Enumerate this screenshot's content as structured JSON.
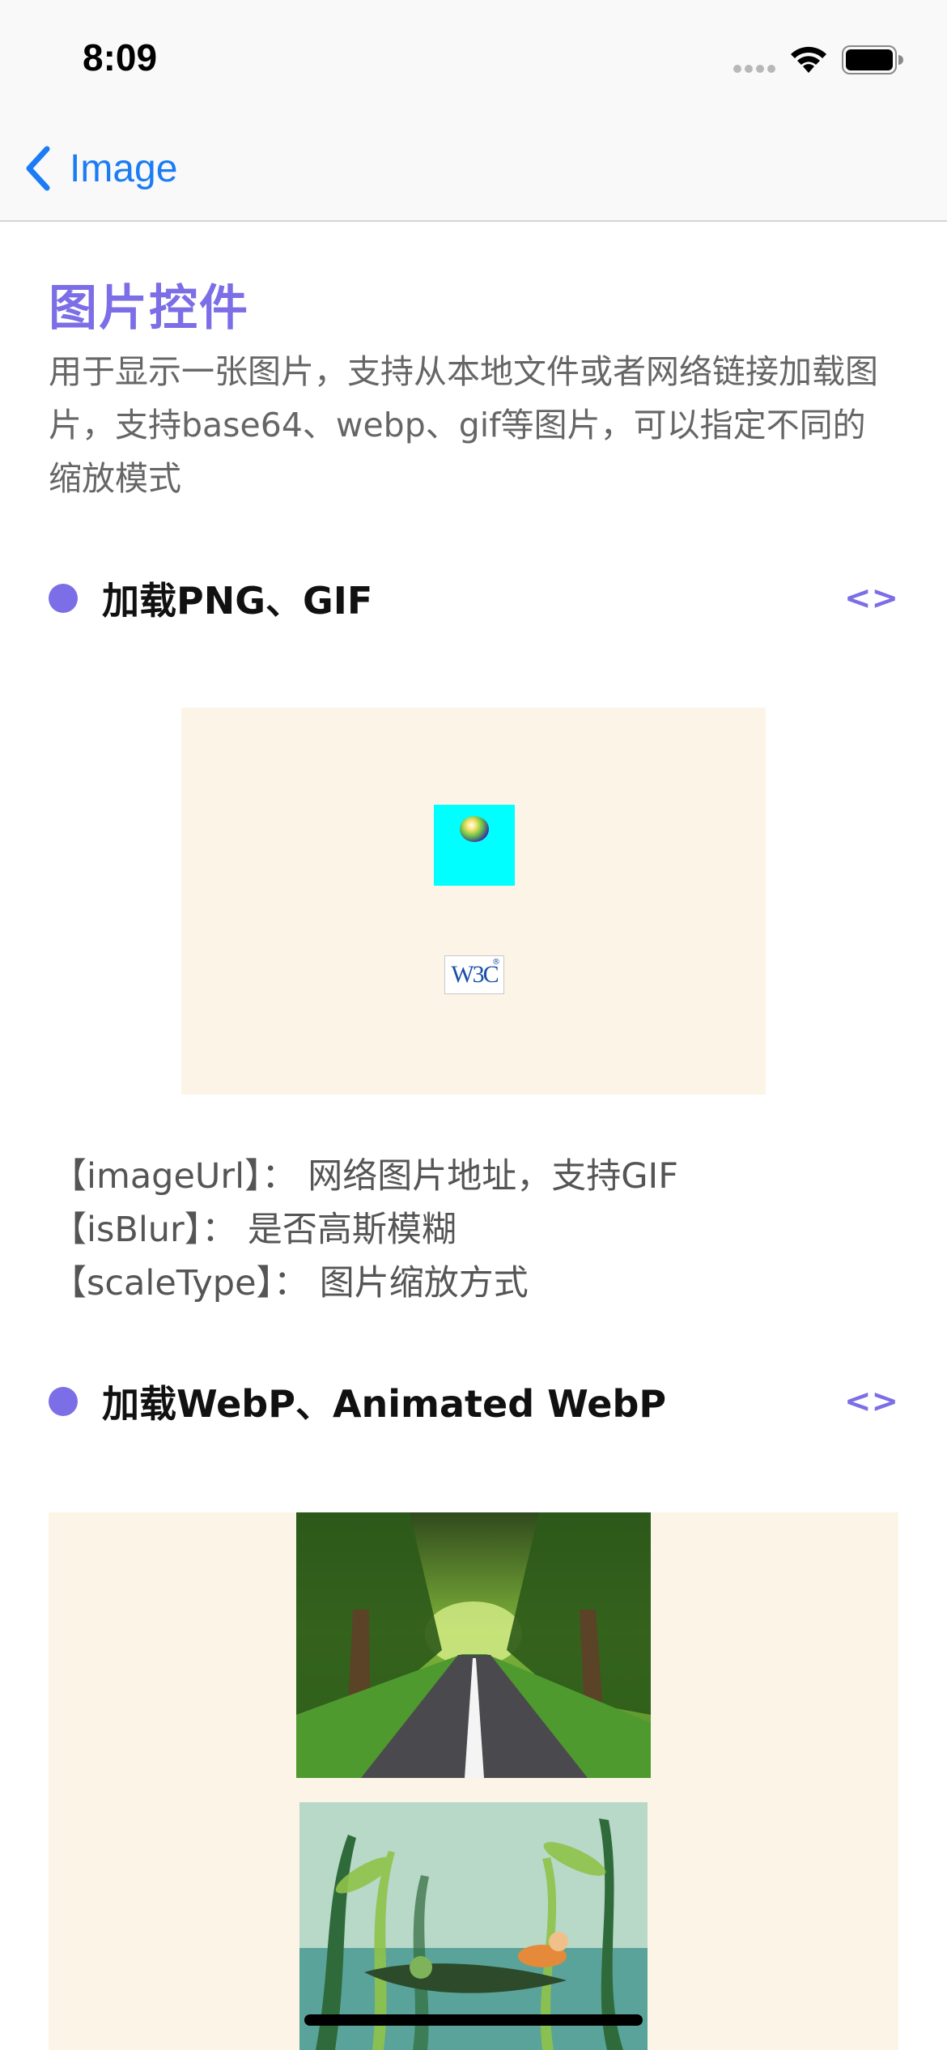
{
  "status_bar": {
    "time": "8:09"
  },
  "nav": {
    "back_label": "Image"
  },
  "header": {
    "title": "图片控件",
    "description": "用于显示一张图片，支持从本地文件或者网络链接加载图片，支持base64、webp、gif等图片，可以指定不同的缩放模式"
  },
  "sections": [
    {
      "title": "加载PNG、GIF",
      "code_label": "<>"
    },
    {
      "title": "加载WebP、Animated WebP",
      "code_label": "<>"
    }
  ],
  "demo1": {
    "logo_text": "W3C",
    "logo_mark": "®"
  },
  "props": [
    {
      "text": "【imageUrl】： 网络图片地址，支持GIF"
    },
    {
      "text": "【isBlur】： 是否高斯模糊"
    },
    {
      "text": "【scaleType】： 图片缩放方式"
    }
  ],
  "colors": {
    "accent": "#7b6ee6",
    "link": "#1b7cf5",
    "demo_bg": "#fcf4e6",
    "cyan": "#00ffff"
  }
}
